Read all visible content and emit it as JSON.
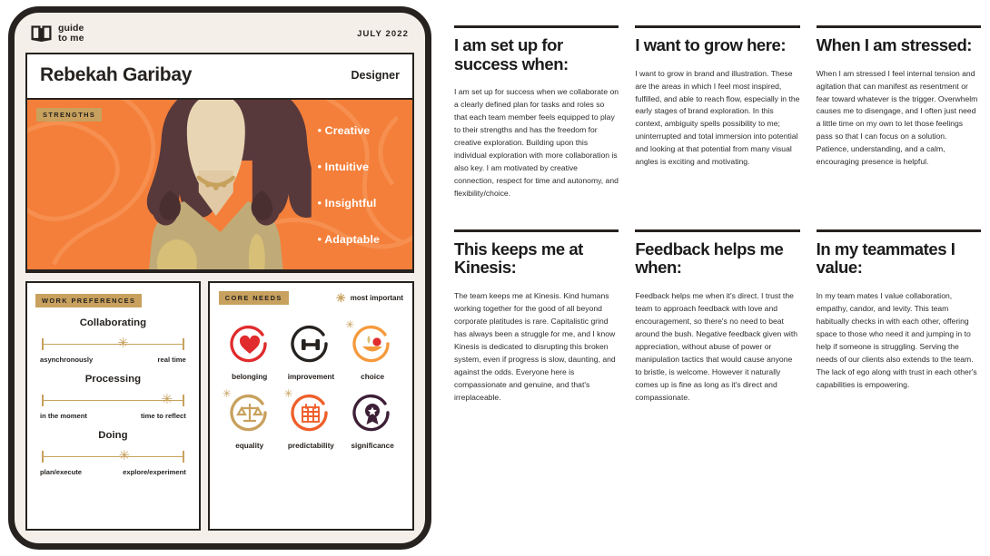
{
  "device": {
    "brand_line1": "guide",
    "brand_line2": "to me",
    "brand_icon": "open-book-icon",
    "date": "JULY 2022"
  },
  "profile": {
    "name": "Rebekah Garibay",
    "role": "Designer",
    "strengths_tag": "STRENGTHS",
    "strengths": [
      "Creative",
      "Intuitive",
      "Insightful",
      "Adaptable"
    ]
  },
  "work_preferences": {
    "tag": "WORK PREFERENCES",
    "items": [
      {
        "title": "Collaborating",
        "left": "asynchronously",
        "right": "real time",
        "position": 57
      },
      {
        "title": "Processing",
        "left": "in the moment",
        "right": "time to reflect",
        "position": 88
      },
      {
        "title": "Doing",
        "left": "plan/execute",
        "right": "explore/experiment",
        "position": 58
      }
    ]
  },
  "core_needs": {
    "tag": "CORE NEEDS",
    "legend": "most important",
    "legend_icon": "star-icon",
    "items": [
      {
        "label": "belonging",
        "icon": "heart-icon",
        "color": "#e02c2c",
        "important": false
      },
      {
        "label": "improvement",
        "icon": "dumbbell-icon",
        "color": "#26221f",
        "important": false
      },
      {
        "label": "choice",
        "icon": "fruit-bowl-icon",
        "color": "#f59a3c",
        "important": true
      },
      {
        "label": "equality",
        "icon": "scales-icon",
        "color": "#c8a15e",
        "important": true
      },
      {
        "label": "predictability",
        "icon": "calendar-icon",
        "color": "#ef5f2b",
        "important": true
      },
      {
        "label": "significance",
        "icon": "award-icon",
        "color": "#3d1f37",
        "important": false
      }
    ]
  },
  "sections": [
    {
      "title": "I am set up for success when:",
      "body": "I am set up for success when we collaborate on a clearly defined plan for tasks and roles so that each team member feels equipped to play to their strengths and has the freedom for creative exploration. Building upon this individual exploration with more collaboration is also key. I am motivated by creative connection, respect for time and autonomy, and flexibility/choice."
    },
    {
      "title": "I want to grow here:",
      "body": "I want to grow in brand and illustration. These are the areas in which I feel most inspired, fulfilled, and able to reach flow, especially in the early stages of brand exploration. In this context, ambiguity spells possibility to me; uninterrupted and total immersion into potential and looking at that potential from many visual angles is exciting and motivating."
    },
    {
      "title": "When I am stressed:",
      "body": "When I am stressed I feel internal tension and agitation that can manifest as resentment or fear toward whatever is the trigger. Overwhelm causes me to disengage, and I often just need a little time on my own to let those feelings pass so that I can focus on a solution. Patience, understanding, and a calm, encouraging presence is helpful."
    },
    {
      "title": "This keeps me at Kinesis:",
      "body": "The team keeps me at Kinesis. Kind humans working together for the good of all beyond corporate platitudes is rare. Capitalistic grind has always been a struggle for me, and I know Kinesis is dedicated to disrupting this broken system, even if progress is slow, daunting, and against the odds. Everyone here is compassionate and genuine, and that's irreplaceable."
    },
    {
      "title": "Feedback helps me when:",
      "body": "Feedback helps me when it's direct. I trust the team to approach feedback with love and encouragement, so there's no need to beat around the bush. Negative feedback given with appreciation, without abuse of power or manipulation tactics that would cause anyone to bristle, is welcome. However it naturally comes up is fine as long as it's direct and compassionate."
    },
    {
      "title": "In my teammates I value:",
      "body": "In my team mates I value collaboration, empathy, candor, and levity. This team habitually checks in with each other, offering space to those who need it and jumping in to help if someone is struggling. Serving the needs of our clients also extends to the team. The lack of ego along with trust in each other's capabilities is empowering."
    }
  ],
  "colors": {
    "orange": "#f47f3a",
    "ink": "#26221f",
    "cream": "#f4f0e9",
    "gold": "#c8a15e"
  }
}
